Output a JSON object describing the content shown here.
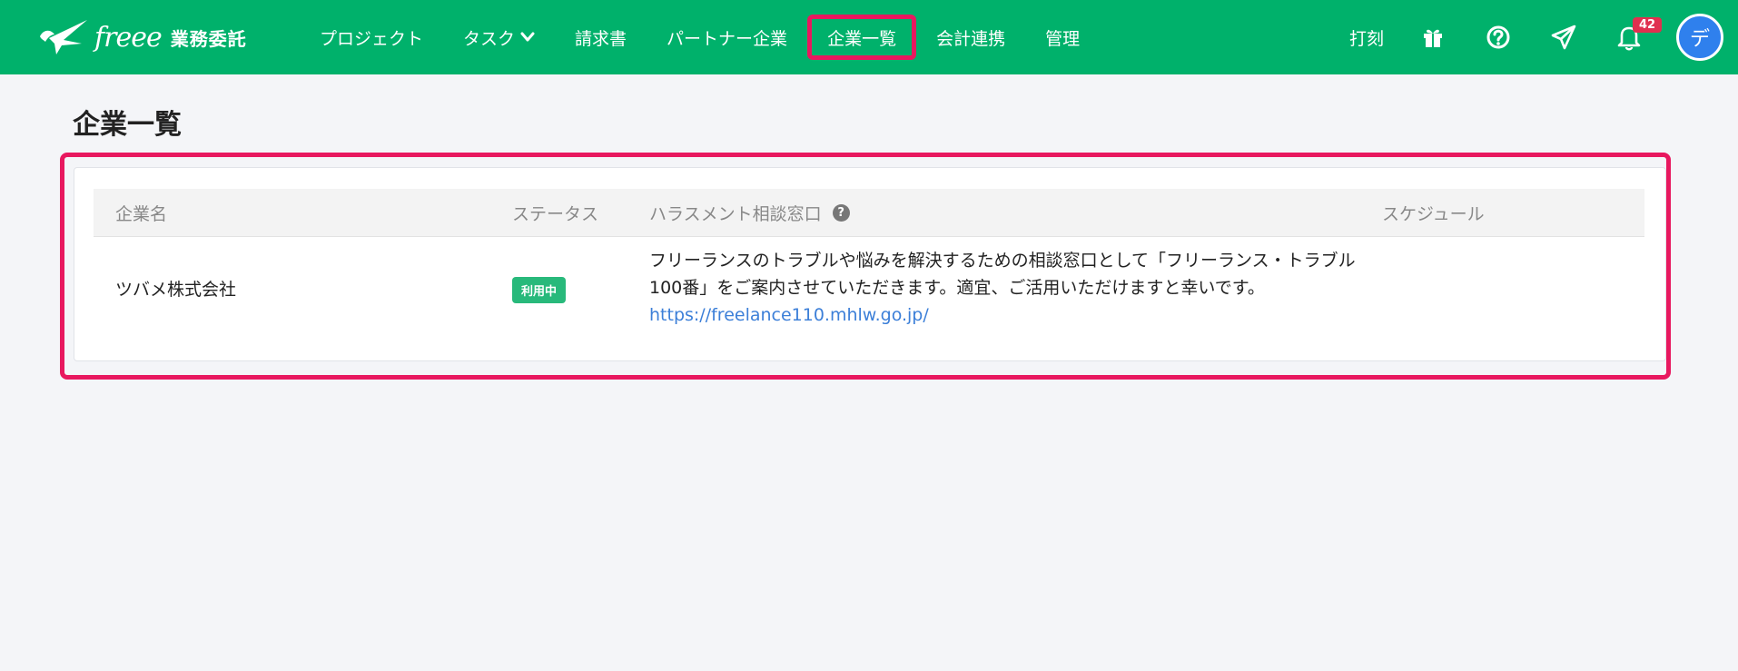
{
  "header": {
    "logo_text": "freee",
    "logo_sub": "業務委託",
    "nav": [
      {
        "label": "プロジェクト"
      },
      {
        "label": "タスク"
      },
      {
        "label": "請求書"
      },
      {
        "label": "パートナー企業"
      },
      {
        "label": "企業一覧"
      },
      {
        "label": "会計連携"
      },
      {
        "label": "管理"
      }
    ],
    "punch_label": "打刻",
    "notification_count": "42",
    "avatar_initial": "デ"
  },
  "page": {
    "title": "企業一覧"
  },
  "table": {
    "columns": [
      "企業名",
      "ステータス",
      "ハラスメント相談窓口",
      "スケジュール"
    ],
    "rows": [
      {
        "company": "ツバメ株式会社",
        "status": "利用中",
        "harassment_text": "フリーランスのトラブルや悩みを解決するための相談窓口として「フリーランス・トラブル100番」をご案内させていただきます。適宜、ご活用いただけますと幸いです。",
        "harassment_link": "https://freelance110.mhlw.go.jp/",
        "schedule": ""
      }
    ]
  },
  "colors": {
    "brand": "#00b16b",
    "highlight": "#e8185f",
    "status": "#28b97b",
    "link": "#3c7fd8"
  },
  "icons": [
    "freee-bird-logo-icon",
    "chevron-down-icon",
    "gift-icon",
    "help-icon",
    "send-icon",
    "bell-icon",
    "question-circle-icon"
  ]
}
